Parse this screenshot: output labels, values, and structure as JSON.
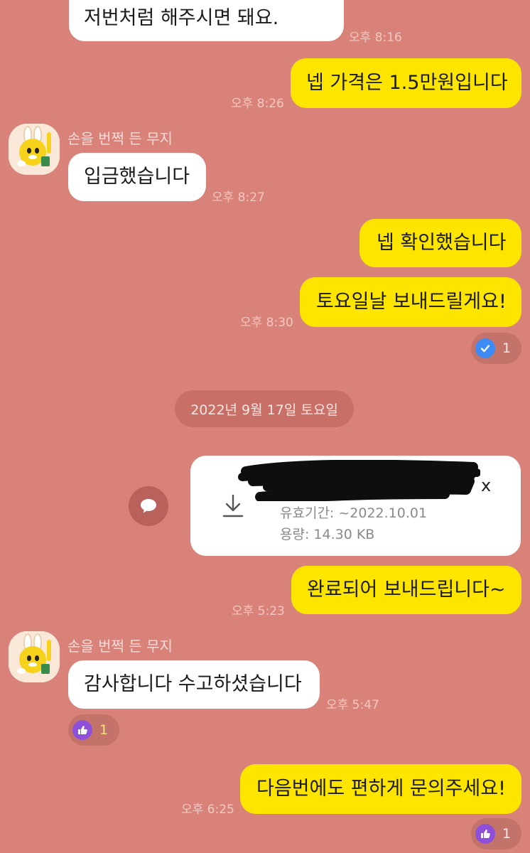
{
  "messages": {
    "m0_line2": "저번처럼 해주시면 돼요.",
    "m0_time": "오후 8:16",
    "m1_text": "넵 가격은 1.5만원입니다",
    "m1_time": "오후 8:26",
    "sender_name": "손을 번쩍 든 무지",
    "m2_text": "입금했습니다",
    "m2_time": "오후 8:27",
    "m3_text": "넵 확인했습니다",
    "m4_text": "토요일날 보내드릴게요!",
    "m4_time": "오후 8:30",
    "m4_reaction_count": "1",
    "date_divider": "2022년 9월 17일 토요일",
    "file": {
      "name_tail": "x",
      "expiry": "유효기간: ~2022.10.01",
      "size": "용량: 14.30 KB"
    },
    "m5_text": "완료되어 보내드립니다~",
    "m5_time": "오후 5:23",
    "m6_text": "감사합니다 수고하셨습니다",
    "m6_time": "오후 5:47",
    "m6_reaction_count": "1",
    "m7_text": "다음번에도 편하게 문의주세요!",
    "m7_time": "오후 6:25",
    "m7_reaction_count": "1"
  },
  "colors": {
    "background": "#d9827a",
    "my_bubble": "#fee500",
    "their_bubble": "#ffffff",
    "check_reaction": "#3d8bf5",
    "like_reaction": "#8e4fd9"
  },
  "icons": {
    "avatar": "muzi-rabbit-avatar",
    "check_reaction": "check-circle-icon",
    "like_reaction": "thumbs-up-icon",
    "download": "download-icon",
    "share": "speech-bubble-icon"
  }
}
